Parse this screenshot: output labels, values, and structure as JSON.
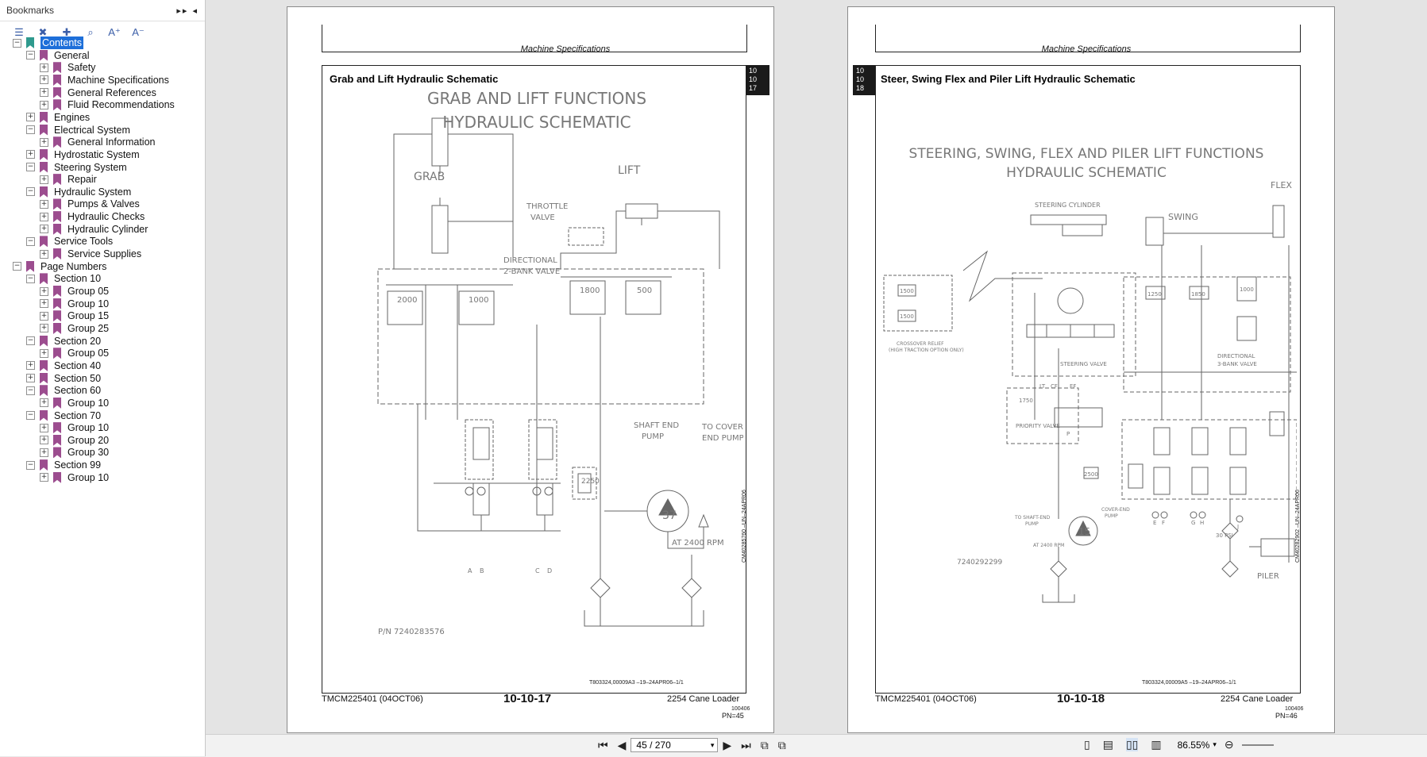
{
  "sidebar": {
    "title": "Bookmarks",
    "header_controls": "▸▸ ◂",
    "toolbar": [
      {
        "name": "options-icon",
        "glyph": "☰"
      },
      {
        "name": "delete-bookmark-icon",
        "glyph": "✖"
      },
      {
        "name": "new-bookmark-icon",
        "glyph": "✚"
      },
      {
        "name": "find-bookmark-icon",
        "glyph": "⌕"
      },
      {
        "name": "increase-text-icon",
        "glyph": "A⁺"
      },
      {
        "name": "decrease-text-icon",
        "glyph": "A⁻"
      }
    ],
    "tree": [
      {
        "label": "Contents",
        "level": 0,
        "exp": "−",
        "selected": true
      },
      {
        "label": "General",
        "level": 1,
        "exp": "−"
      },
      {
        "label": "Safety",
        "level": 2,
        "exp": "+"
      },
      {
        "label": "Machine Specifications",
        "level": 2,
        "exp": "+"
      },
      {
        "label": "General References",
        "level": 2,
        "exp": "+"
      },
      {
        "label": "Fluid Recommendations",
        "level": 2,
        "exp": "+"
      },
      {
        "label": "Engines",
        "level": 1,
        "exp": "+"
      },
      {
        "label": "Electrical System",
        "level": 1,
        "exp": "−"
      },
      {
        "label": "General Information",
        "level": 2,
        "exp": "+"
      },
      {
        "label": "Hydrostatic System",
        "level": 1,
        "exp": "+"
      },
      {
        "label": "Steering System",
        "level": 1,
        "exp": "−"
      },
      {
        "label": "Repair",
        "level": 2,
        "exp": "+"
      },
      {
        "label": "Hydraulic System",
        "level": 1,
        "exp": "−"
      },
      {
        "label": "Pumps & Valves",
        "level": 2,
        "exp": "+"
      },
      {
        "label": "Hydraulic Checks",
        "level": 2,
        "exp": "+"
      },
      {
        "label": "Hydraulic Cylinder",
        "level": 2,
        "exp": "+"
      },
      {
        "label": "Service Tools",
        "level": 1,
        "exp": "−"
      },
      {
        "label": "Service Supplies",
        "level": 2,
        "exp": "+"
      },
      {
        "label": "Page Numbers",
        "level": 0,
        "exp": "−"
      },
      {
        "label": "Section 10",
        "level": 1,
        "exp": "−"
      },
      {
        "label": "Group 05",
        "level": 2,
        "exp": "+"
      },
      {
        "label": "Group 10",
        "level": 2,
        "exp": "+"
      },
      {
        "label": "Group 15",
        "level": 2,
        "exp": "+"
      },
      {
        "label": "Group 25",
        "level": 2,
        "exp": "+"
      },
      {
        "label": "Section 20",
        "level": 1,
        "exp": "−"
      },
      {
        "label": "Group 05",
        "level": 2,
        "exp": "+"
      },
      {
        "label": "Section 40",
        "level": 1,
        "exp": "+"
      },
      {
        "label": "Section 50",
        "level": 1,
        "exp": "+"
      },
      {
        "label": "Section 60",
        "level": 1,
        "exp": "−"
      },
      {
        "label": "Group 10",
        "level": 2,
        "exp": "+"
      },
      {
        "label": "Section 70",
        "level": 1,
        "exp": "−"
      },
      {
        "label": "Group 10",
        "level": 2,
        "exp": "+"
      },
      {
        "label": "Group 20",
        "level": 2,
        "exp": "+"
      },
      {
        "label": "Group 30",
        "level": 2,
        "exp": "+"
      },
      {
        "label": "Section 99",
        "level": 1,
        "exp": "−"
      },
      {
        "label": "Group 10",
        "level": 2,
        "exp": "+"
      }
    ]
  },
  "left_page": {
    "header": "Machine Specifications",
    "title": "Grab and Lift Hydraulic Schematic",
    "tab": [
      "10",
      "10",
      "17"
    ],
    "schematic_title_1": "GRAB AND LIFT FUNCTIONS",
    "schematic_title_2": "HYDRAULIC SCHEMATIC",
    "labels": {
      "grab": "GRAB",
      "lift": "LIFT",
      "throttle_1": "THROTTLE",
      "throttle_2": "VALVE",
      "dir_1": "DIRECTIONAL",
      "dir_2": "2-BANK VALVE",
      "v2000": "2000",
      "v1000": "1000",
      "v1800": "1800",
      "v500": "500",
      "v2250": "2250",
      "shaft_1": "SHAFT END",
      "shaft_2": "PUMP",
      "pump_num": "37",
      "cover_1": "TO COVER",
      "cover_2": "END PUMP",
      "rpm": "AT 2400 RPM",
      "pn": "P/N 7240283576",
      "pa": "A",
      "pb": "B",
      "pc": "C",
      "pd": "D"
    },
    "side_code": "CM40285760 –UN–24APR06",
    "ref_code": "T803324,00009A3 –19–24APR06–1/1",
    "doc_id": "TMCM225401 (04OCT06)",
    "page_num": "10-10-17",
    "model": "2254 Cane Loader",
    "small_code": "100406",
    "pn": "PN=45"
  },
  "right_page": {
    "header": "Machine Specifications",
    "title": "Steer, Swing Flex and Piler Lift Hydraulic Schematic",
    "tab": [
      "10",
      "10",
      "18"
    ],
    "schematic_title_1": "STEERING, SWING, FLEX AND PILER LIFT FUNCTIONS",
    "schematic_title_2": "HYDRAULIC SCHEMATIC",
    "labels": {
      "steer_cyl": "STEERING CYLINDER",
      "swing": "SWING",
      "flex": "FLEX",
      "v1500a": "1500",
      "v1500b": "1500",
      "crossover_1": "CROSSOVER RELIEF",
      "crossover_2": "(HIGH TRACTION OPTION ONLY)",
      "steer_valve": "STEERING VALVE",
      "priority": "PRIORITY VALVE",
      "dir_1": "DIRECTIONAL",
      "dir_2": "3-BANK VALVE",
      "v1250": "1250",
      "v1850": "1850",
      "v1000": "1000",
      "v2500": "2500",
      "v1750": "1750",
      "shaft_1": "TO SHAFT-END",
      "shaft_2": "PUMP",
      "cover_1": "COVER-END",
      "cover_2": "PUMP",
      "pump_num": "15",
      "rpm": "AT 2400 RPM",
      "psi": "30 PSI",
      "pn": "7240292299",
      "piler": "PILER",
      "pe": "E",
      "pf": "F",
      "pg": "G",
      "ph": "H",
      "pj": "J",
      "lt": "LT",
      "cf": "CF",
      "ef": "EF",
      "p": "P"
    },
    "side_code": "CM40282902 –UN–24APR06",
    "ref_code": "T803324,00009A5 –19–24APR06–1/1",
    "doc_id": "TMCM225401 (04OCT06)",
    "page_num": "10-10-18",
    "model": "2254 Cane Loader",
    "small_code": "100406",
    "pn": "PN=46"
  },
  "statusbar": {
    "page_field": "45 / 270",
    "zoom": "86.55%"
  }
}
